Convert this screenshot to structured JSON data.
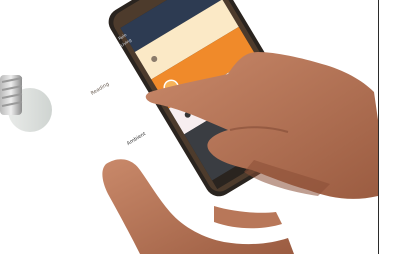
{
  "photo": {
    "subject": "Hands holding a smartphone showing a smart lighting app, light bulb in background"
  },
  "phone_screen": {
    "header": {
      "title_line1": "Rulo",
      "title_line2": "Living"
    },
    "items": [
      {
        "label": "Reading",
        "state": "inactive"
      },
      {
        "label": "Relax",
        "state": "active"
      },
      {
        "label": "Ambient",
        "state": "inactive"
      }
    ]
  },
  "colors": {
    "active_item": "#f08a2a",
    "inactive_item": "#fbe9c6",
    "screen_dark": "#3a3d42",
    "header": "#2d3b52"
  }
}
